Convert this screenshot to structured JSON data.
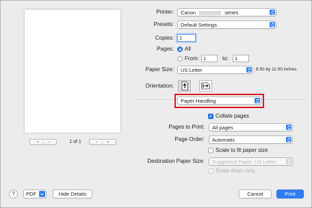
{
  "preview": {
    "page_indicator": "1 of 1",
    "nav_first": "«",
    "nav_prev": "‹",
    "nav_next": "›",
    "nav_last": "»"
  },
  "printer": {
    "label": "Printer:",
    "value_prefix": "Canon",
    "value_suffix": "series"
  },
  "presets": {
    "label": "Presets:",
    "value": "Default Settings"
  },
  "copies": {
    "label": "Copies:",
    "value": "1"
  },
  "pages": {
    "label": "Pages:",
    "all_label": "All",
    "from_label": "From:",
    "from_value": "1",
    "to_label": "to:",
    "to_value": "1"
  },
  "paper_size": {
    "label": "Paper Size:",
    "value": "US Letter",
    "dimensions": "8.50 by 11.00 inches"
  },
  "orientation": {
    "label": "Orientation:",
    "portrait_icon": "portrait-orientation-icon",
    "landscape_icon": "landscape-orientation-icon"
  },
  "section_popup": {
    "value": "Paper Handling"
  },
  "collate": {
    "label": "Collate pages",
    "checked": true
  },
  "pages_to_print": {
    "label": "Pages to Print:",
    "value": "All pages"
  },
  "page_order": {
    "label": "Page Order:",
    "value": "Automatic"
  },
  "scale_to_fit": {
    "label": "Scale to fit paper size",
    "checked": false
  },
  "destination_paper_size": {
    "label": "Destination Paper Size:",
    "value": "Suggested Paper: US Letter"
  },
  "scale_down_only": {
    "label": "Scale down only",
    "checked": false
  },
  "footer": {
    "help": "?",
    "pdf": "PDF",
    "hide_details": "Hide Details",
    "cancel": "Cancel",
    "print": "Print"
  },
  "colors": {
    "accent": "#2f7ef5",
    "highlight_border": "#e0141e",
    "window_bg": "#ececec"
  }
}
